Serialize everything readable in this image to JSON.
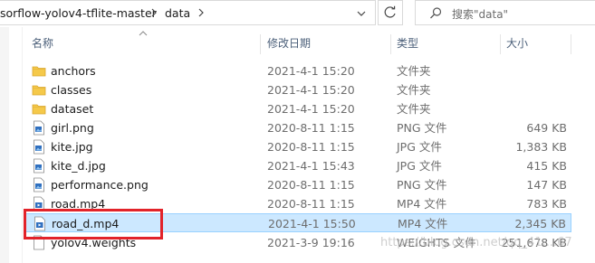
{
  "address": {
    "crumbs": [
      "sorflow-yolov4-tflite-master",
      "data"
    ]
  },
  "search": {
    "placeholder": "搜索\"data\""
  },
  "columns": {
    "name": "名称",
    "date": "修改日期",
    "type": "类型",
    "size": "大小"
  },
  "files": [
    {
      "name": "anchors",
      "date": "2021-4-1 15:20",
      "type": "文件夹",
      "size": "",
      "icon": "folder-icon"
    },
    {
      "name": "classes",
      "date": "2021-4-1 15:20",
      "type": "文件夹",
      "size": "",
      "icon": "folder-icon"
    },
    {
      "name": "dataset",
      "date": "2021-4-1 15:20",
      "type": "文件夹",
      "size": "",
      "icon": "folder-icon"
    },
    {
      "name": "girl.png",
      "date": "2020-8-11 1:15",
      "type": "PNG 文件",
      "size": "649 KB",
      "icon": "image-file-icon"
    },
    {
      "name": "kite.jpg",
      "date": "2020-8-11 1:15",
      "type": "JPG 文件",
      "size": "1,383 KB",
      "icon": "image-file-icon"
    },
    {
      "name": "kite_d.jpg",
      "date": "2021-4-1 15:43",
      "type": "JPG 文件",
      "size": "415 KB",
      "icon": "image-file-icon"
    },
    {
      "name": "performance.png",
      "date": "2020-8-11 1:15",
      "type": "PNG 文件",
      "size": "147 KB",
      "icon": "image-file-icon"
    },
    {
      "name": "road.mp4",
      "date": "2020-8-11 1:15",
      "type": "MP4 文件",
      "size": "783 KB",
      "icon": "video-file-icon"
    },
    {
      "name": "road_d.mp4",
      "date": "2021-4-1 15:50",
      "type": "MP4 文件",
      "size": "2,345 KB",
      "icon": "video-file-icon",
      "selected": true
    },
    {
      "name": "yolov4.weights",
      "date": "2021-3-9 19:16",
      "type": "WEIGHTS 文件",
      "size": "251,678 KB",
      "icon": "blank-file-icon"
    }
  ],
  "watermark": "https://blog.csdn.net/qq_41....67",
  "colors": {
    "selection": "#cce8ff",
    "highlight_box": "#e2232a",
    "folder": "#f5c94a"
  }
}
